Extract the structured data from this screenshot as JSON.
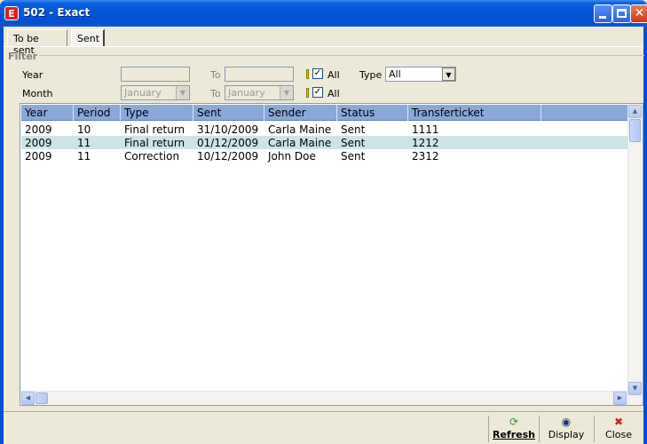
{
  "window": {
    "title": "502  - Exact",
    "app_icon_letter": "E"
  },
  "tabs": [
    {
      "label": "To be sent",
      "active": false
    },
    {
      "label": "Sent",
      "active": true
    }
  ],
  "filter": {
    "group_label": "Filter",
    "year_label": "Year",
    "year_from": "",
    "to_label": "To",
    "year_to": "",
    "all_label": "All",
    "year_all_checked": true,
    "type_label": "Type",
    "type_value": "All",
    "month_label": "Month",
    "month_from": "January",
    "month_to": "January",
    "month_all_checked": true
  },
  "grid": {
    "columns": [
      "Year",
      "Period",
      "Type",
      "Sent",
      "Sender",
      "Status",
      "Transferticket"
    ],
    "rows": [
      [
        "2009",
        "10",
        "Final return",
        "31/10/2009",
        "Carla Maine",
        "Sent",
        "1111"
      ],
      [
        "2009",
        "11",
        "Final return",
        "01/12/2009",
        "Carla Maine",
        "Sent",
        "1212"
      ],
      [
        "2009",
        "11",
        "Correction",
        "10/12/2009",
        " John Doe",
        "Sent",
        "2312"
      ]
    ]
  },
  "toolbar": {
    "refresh_label": "Refresh",
    "display_label": "Display",
    "close_label": "Close"
  },
  "colors": {
    "titlebar": "#0450d0",
    "grid_header": "#89a9d9",
    "row_alt": "#cde4e4",
    "close_icon": "#d0201a"
  }
}
